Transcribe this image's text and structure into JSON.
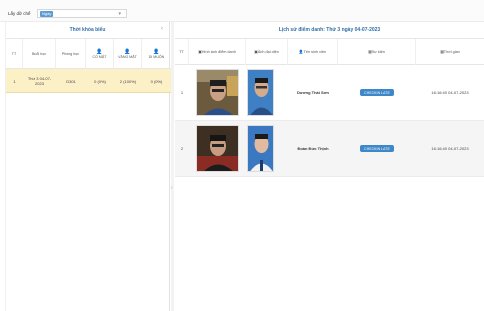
{
  "filter": {
    "label": "Lấy dữ chế",
    "selected": "Ngày"
  },
  "left": {
    "title": "Thời khóa biểu",
    "collapse_icon": "chevron-left",
    "columns": [
      "TT",
      "Buổi học",
      "Phòng học",
      "CÓ MẶT",
      "VẮNG MẶT",
      "DI MUỘN"
    ],
    "row": {
      "tt": "1",
      "session": "Thứ 3 04-07-2023",
      "room": "D301",
      "present": "0 (0%)",
      "absent": "2 (100%)",
      "late": "0 (0%)"
    }
  },
  "right": {
    "title": "Lịch sử điểm danh: Thứ 3 ngày 04-07-2023",
    "columns": [
      "TT",
      "Hình ảnh điểm danh",
      "Ảnh đại diện",
      "Tên sinh viên",
      "Sự kiện",
      "Thời gian"
    ],
    "rows": [
      {
        "tt": "1",
        "name": "Dương Thái Sơn",
        "event": "CHECKIN LATE",
        "time": "16:16:40 04-07-2023"
      },
      {
        "tt": "2",
        "name": "Đoàn Đức Thịnh",
        "event": "CHECKIN LATE",
        "time": "16:16:40 04-07-2023"
      }
    ]
  },
  "colors": {
    "title_blue": "#2f6fa8",
    "highlight_row": "#fcf0c7",
    "badge_blue": "#3e88c9"
  }
}
